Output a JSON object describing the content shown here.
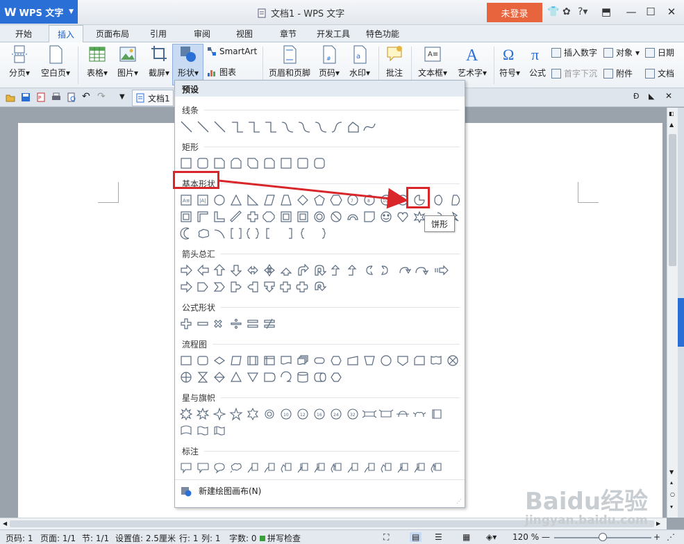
{
  "titlebar": {
    "app_name": "WPS 文字",
    "document_title": "文档1 - WPS 文字",
    "login_label": "未登录"
  },
  "menu": {
    "tabs": [
      "开始",
      "插入",
      "页面布局",
      "引用",
      "审阅",
      "视图",
      "章节",
      "开发工具",
      "特色功能"
    ],
    "active_tab": "插入"
  },
  "ribbon": {
    "page_break": "分页",
    "blank_page": "空白页",
    "table": "表格",
    "picture": "图片",
    "screenshot": "截屏",
    "shapes": "形状",
    "smartart": "SmartArt",
    "chart": "图表",
    "header_footer": "页眉和页脚",
    "page_number": "页码",
    "watermark": "水印",
    "comment": "批注",
    "textbox": "文本框",
    "wordart": "艺术字",
    "symbol": "符号",
    "formula": "公式",
    "insert_number": "插入数字",
    "drop_cap": "首字下沉",
    "object": "对象",
    "attachment": "附件",
    "date": "日期",
    "document_parts": "文档"
  },
  "quick_access": {
    "document_tab": "文档1"
  },
  "shapes_panel": {
    "header": "预设",
    "categories": {
      "lines": "线条",
      "rectangles": "矩形",
      "basic": "基本形状",
      "arrows": "箭头总汇",
      "equation": "公式形状",
      "flowchart": "流程图",
      "stars": "星与旗帜",
      "callouts": "标注"
    },
    "new_canvas": "新建绘图画布(N)",
    "tooltip": "饼形"
  },
  "statusbar": {
    "page": "页码: 1",
    "pages": "页面: 1/1",
    "section": "节: 1/1",
    "setting": "设置值: 2.5厘米",
    "row": "行: 1",
    "col": "列: 1",
    "words": "字数: 0",
    "spell": "拼写检查",
    "zoom": "120 %"
  },
  "watermark": {
    "brand": "Baidu经验",
    "url": "jingyan.baidu.com"
  },
  "colors": {
    "accent_blue": "#2a6fd6",
    "login_orange": "#e8643c",
    "highlight_red": "#d8262b"
  }
}
